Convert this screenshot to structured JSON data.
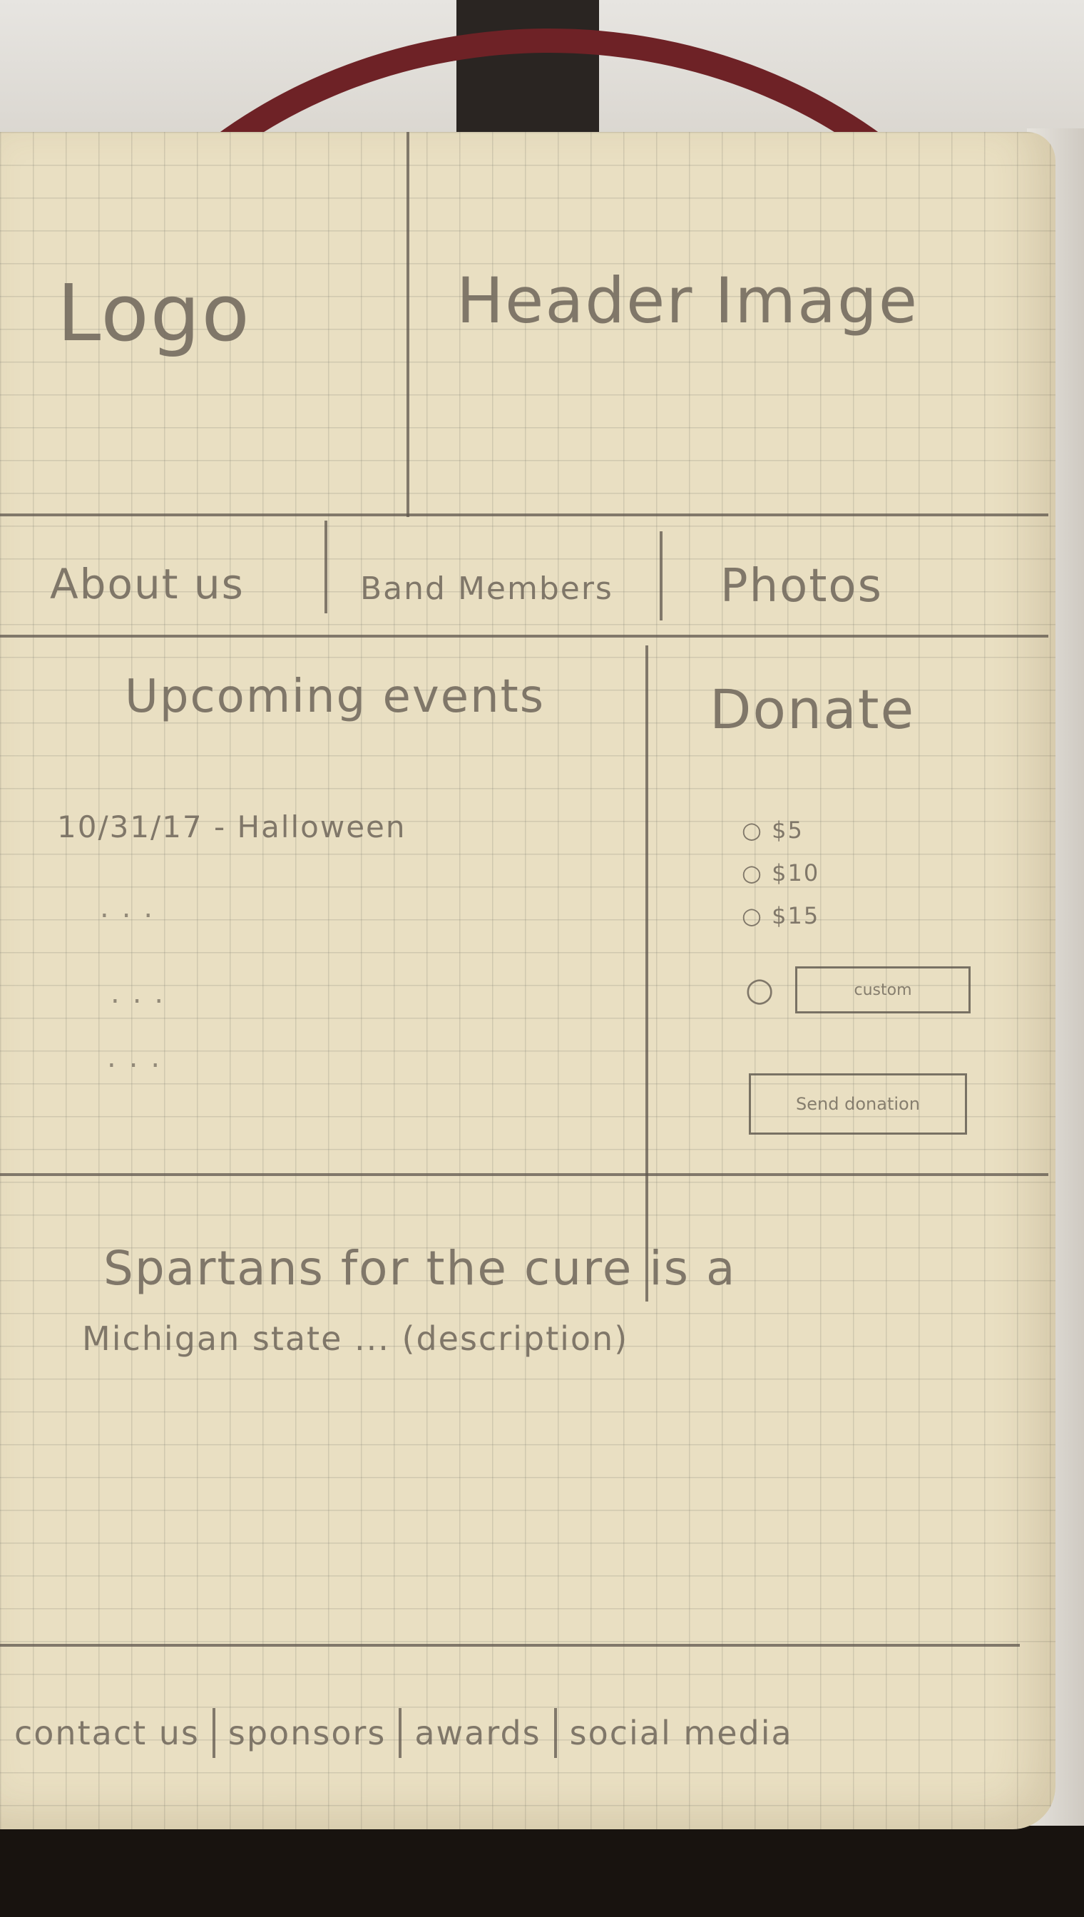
{
  "header": {
    "logo": "Logo",
    "header_image": "Header Image"
  },
  "nav": {
    "items": [
      {
        "label": "About us"
      },
      {
        "label": "Band Members"
      },
      {
        "label": "Photos"
      }
    ]
  },
  "events": {
    "title": "Upcoming events",
    "items": [
      {
        "text": "10/31/17 - Halloween"
      },
      {
        "text": "..."
      },
      {
        "text": "..."
      },
      {
        "text": "..."
      }
    ]
  },
  "donate": {
    "title": "Donate",
    "options": [
      "$5",
      "$10",
      "$15"
    ],
    "custom_placeholder": "custom",
    "submit_label": "Send donation"
  },
  "description": {
    "line1": "Spartans for the cure is a",
    "line2": "Michigan state ... (description)"
  },
  "footer": {
    "items": [
      {
        "label": "contact us"
      },
      {
        "label": "sponsors"
      },
      {
        "label": "awards"
      },
      {
        "label": "social media"
      }
    ]
  }
}
